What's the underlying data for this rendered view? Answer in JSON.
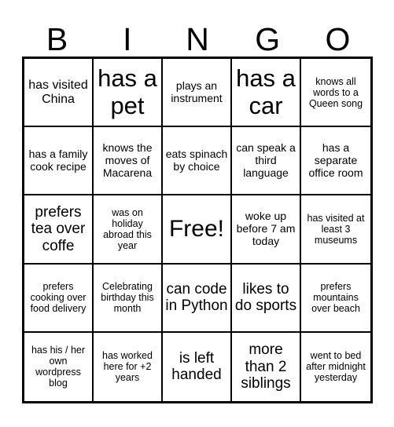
{
  "card": {
    "title_letters": [
      "B",
      "I",
      "N",
      "G",
      "O"
    ],
    "free_space_label": "Free!",
    "grid_size": 5,
    "colors": {
      "background": "#ffffff",
      "border": "#000000",
      "text": "#000000"
    },
    "rows": [
      [
        {
          "text": "has visited China",
          "size": "sm"
        },
        {
          "text": "has a pet",
          "size": "xl"
        },
        {
          "text": "plays an instrument",
          "size": "xs"
        },
        {
          "text": "has a car",
          "size": "xl"
        },
        {
          "text": "knows all words to a Queen song",
          "size": "xxs"
        }
      ],
      [
        {
          "text": "has a family cook recipe",
          "size": "xs"
        },
        {
          "text": "knows the moves of Macarena",
          "size": "xs"
        },
        {
          "text": "eats spinach by choice",
          "size": "xs"
        },
        {
          "text": "can speak a third language",
          "size": "xs"
        },
        {
          "text": "has a separate office room",
          "size": "xs"
        }
      ],
      [
        {
          "text": "prefers tea over coffe",
          "size": "md"
        },
        {
          "text": "was on holiday abroad this year",
          "size": "xxs"
        },
        {
          "text": "Free!",
          "size": "lg"
        },
        {
          "text": "woke up before 7 am today",
          "size": "xs"
        },
        {
          "text": "has visited at least 3 museums",
          "size": "xxs"
        }
      ],
      [
        {
          "text": "prefers cooking over food delivery",
          "size": "xxs"
        },
        {
          "text": "Celebrating birthday this month",
          "size": "xxs"
        },
        {
          "text": "can code in Python",
          "size": "md"
        },
        {
          "text": "likes to do sports",
          "size": "md"
        },
        {
          "text": "prefers mountains over beach",
          "size": "xxs"
        }
      ],
      [
        {
          "text": "has his / her own wordpress blog",
          "size": "xxs"
        },
        {
          "text": "has worked here for +2 years",
          "size": "xxs"
        },
        {
          "text": "is left handed",
          "size": "md"
        },
        {
          "text": "more than 2 siblings",
          "size": "md"
        },
        {
          "text": "went to bed after midnight yesterday",
          "size": "xxs"
        }
      ]
    ]
  }
}
